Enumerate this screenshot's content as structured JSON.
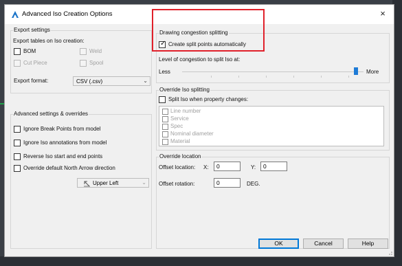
{
  "dialog": {
    "title": "Advanced Iso Creation Options",
    "close_glyph": "×"
  },
  "export_settings": {
    "group_label": "Export settings",
    "tables_label": "Export tables on Iso creation:",
    "bom_label": "BOM",
    "weld_label": "Weld",
    "cut_piece_label": "Cut Piece",
    "spool_label": "Spool",
    "format_label": "Export format:",
    "format_value": "CSV (.csv)"
  },
  "advanced": {
    "group_label": "Advanced settings & overrides",
    "ignore_break_points": "Ignore Break Points from model",
    "ignore_iso_annotations": "Ignore Iso annotations from model",
    "reverse_iso": "Reverse Iso start and end points",
    "override_north_arrow": "Override default North Arrow direction",
    "north_arrow_value": "Upper Left"
  },
  "congestion": {
    "group_label": "Drawing congestion splitting",
    "create_split_label": "Create split points automatically",
    "create_split_checked": true,
    "level_label": "Level of congestion to split Iso at:",
    "less_label": "Less",
    "more_label": "More",
    "slider_level": 1.0
  },
  "override_iso": {
    "group_label": "Override Iso splitting",
    "split_label": "Split Iso when property changes:",
    "properties": [
      "Line number",
      "Service",
      "Spec",
      "Nominal diameter",
      "Material"
    ]
  },
  "override_location": {
    "group_label": "Override location",
    "offset_label": "Offset location:",
    "x_label": "X:",
    "x_value": "0",
    "y_label": "Y:",
    "y_value": "0",
    "rotation_label": "Offset rotation:",
    "rotation_value": "0",
    "deg_label": "DEG."
  },
  "buttons": {
    "ok": "OK",
    "cancel": "Cancel",
    "help": "Help"
  },
  "colors": {
    "highlight": "#e0202a",
    "accent": "#1e7bd6"
  }
}
